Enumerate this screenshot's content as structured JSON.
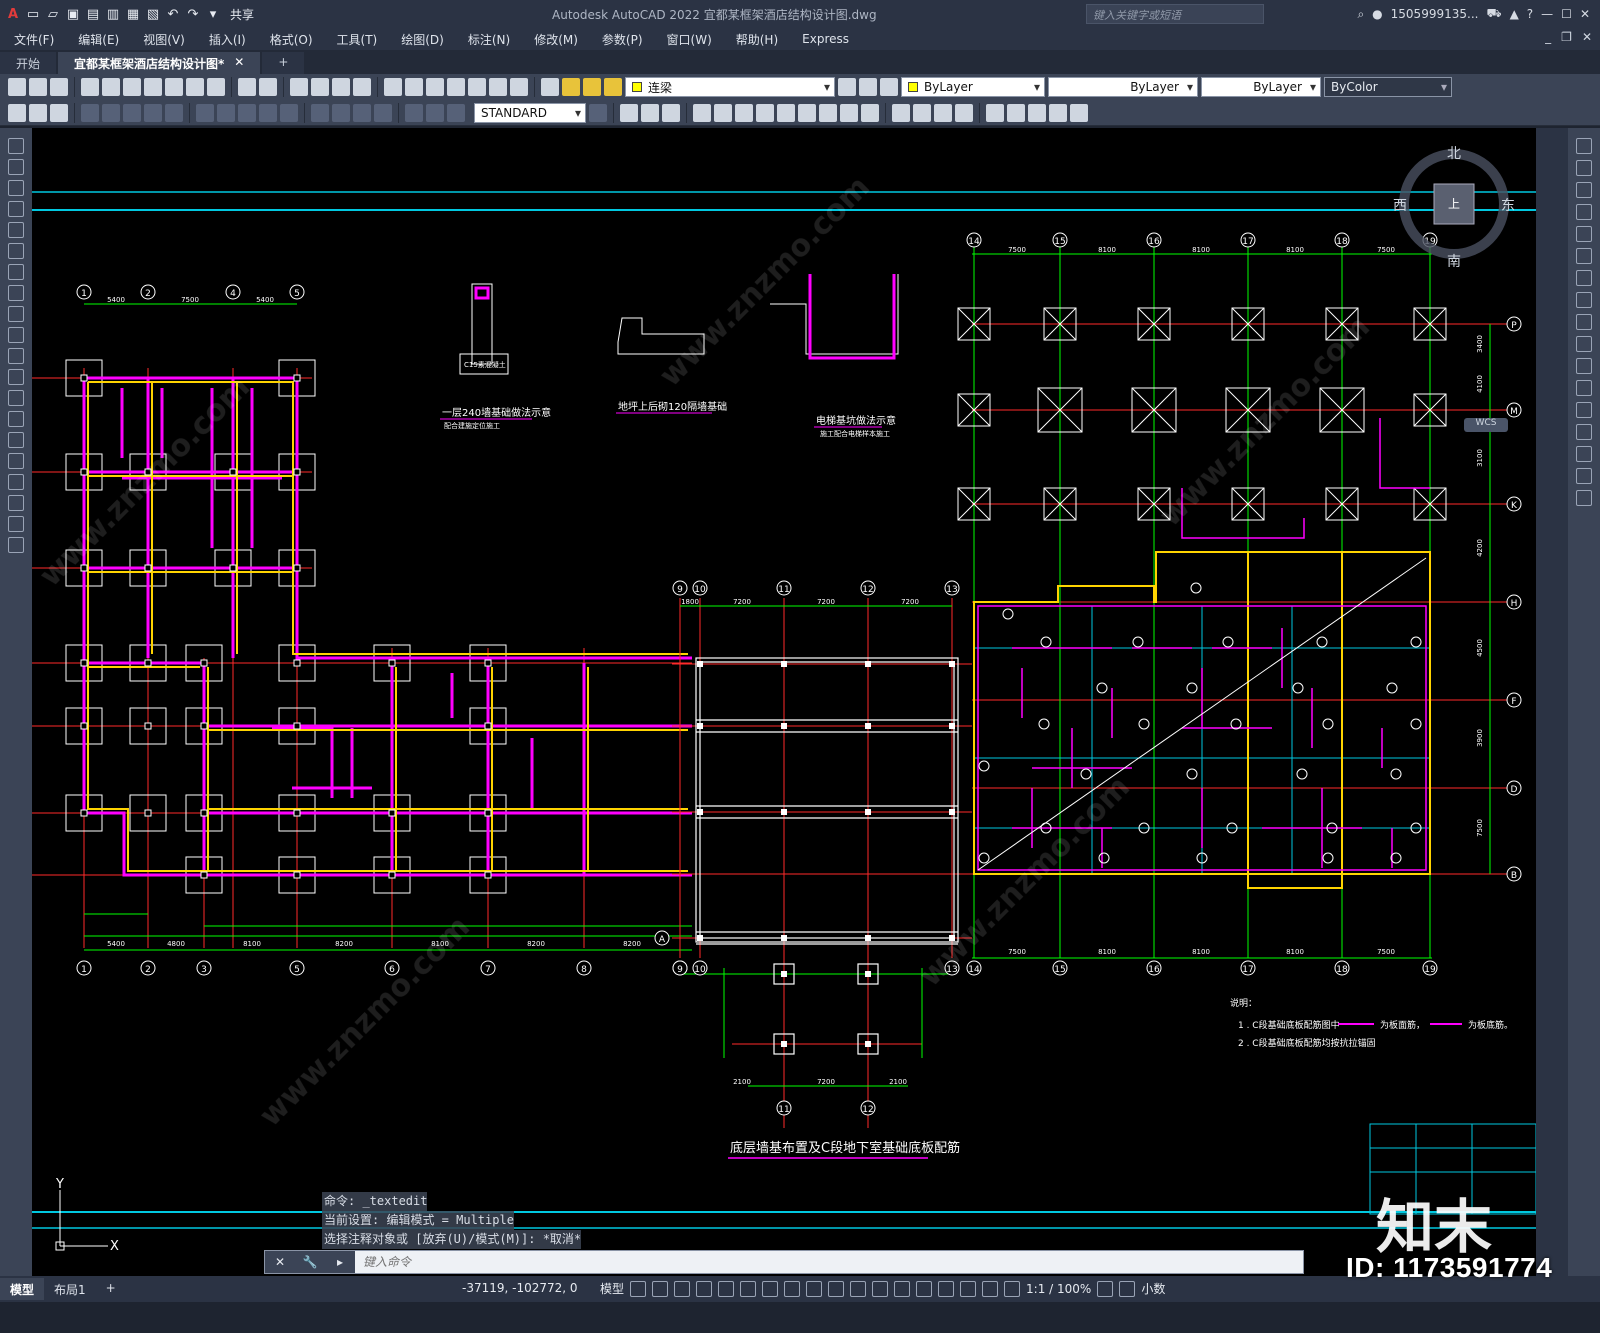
{
  "app": {
    "window_title": "Autodesk AutoCAD 2022    宜都某框架酒店结构设计图.dwg",
    "share_label": "共享",
    "search_placeholder": "键入关键字或短语",
    "user": "1505999135...",
    "logo_letter": "A"
  },
  "menu": [
    "文件(F)",
    "编辑(E)",
    "视图(V)",
    "插入(I)",
    "格式(O)",
    "工具(T)",
    "绘图(D)",
    "标注(N)",
    "修改(M)",
    "参数(P)",
    "窗口(W)",
    "帮助(H)",
    "Express"
  ],
  "tabs": [
    {
      "label": "开始",
      "active": false
    },
    {
      "label": "宜都某框架酒店结构设计图*",
      "active": true
    }
  ],
  "toolbar": {
    "layer_name": "连梁",
    "color": "ByLayer",
    "linetype": "ByLayer",
    "lineweight": "ByLayer",
    "plotstyle": "ByColor",
    "textstyle": "STANDARD"
  },
  "viewcube": {
    "north": "北",
    "south": "南",
    "east": "东",
    "west": "西",
    "top": "上",
    "wcs": "WCS"
  },
  "drawing": {
    "title": "底层墙基布置及C段地下室基础底板配筋",
    "detail1_title": "一层240墙基础做法示意",
    "detail1_sub": "配合建施定位施工",
    "detail1_label": "C15素混凝土",
    "detail2_title": "地坪上后砌120隔墙基础",
    "detail3_title": "电梯基坑做法示意",
    "detail3_sub": "施工配合电梯样本施工",
    "notes_title": "说明：",
    "note1": "1 . C段基础底板配筋图中",
    "note1_a": "为板面筋，",
    "note1_b": "为板底筋。",
    "note2": "2 . C段基础底板配筋均按抗拉锚固",
    "grid_left_top": [
      "1",
      "2",
      "4",
      "5"
    ],
    "grid_left_bottom": [
      "1",
      "2",
      "3",
      "5",
      "6",
      "7",
      "8",
      "9"
    ],
    "grid_mid_top": [
      "9",
      "10",
      "11",
      "12",
      "13"
    ],
    "grid_mid_bottom": [
      "9",
      "10",
      "13"
    ],
    "grid_mid_sub": [
      "11",
      "12"
    ],
    "grid_right": [
      "14",
      "15",
      "16",
      "17",
      "18",
      "19"
    ],
    "grid_right_rows": [
      "P",
      "M",
      "K",
      "H",
      "F",
      "D",
      "B"
    ],
    "grid_a": "A",
    "dims_left_top": [
      "5400",
      "7500",
      "5400"
    ],
    "dims_left_bottom": [
      "5400",
      "4800",
      "8100",
      "8200",
      "8100",
      "8200",
      "8200"
    ],
    "dims_mid_top": [
      "1800",
      "7200",
      "7200",
      "7200"
    ],
    "dims_mid_sub": [
      "2100",
      "7200",
      "2100"
    ],
    "dims_right_top": [
      "7500",
      "8100",
      "8100",
      "8100",
      "7500"
    ],
    "dims_right_side": [
      "3400",
      "4100",
      "3100",
      "4200",
      "4500",
      "3900",
      "7500"
    ]
  },
  "command": {
    "history": [
      "命令: _textedit",
      "当前设置: 编辑模式 = Multiple",
      "选择注释对象或 [放弃(U)/模式(M)]: *取消*"
    ],
    "placeholder": "键入命令"
  },
  "status": {
    "tabs": [
      {
        "label": "模型",
        "active": true
      },
      {
        "label": "布局1",
        "active": false
      }
    ],
    "coords": "-37119, -102772, 0",
    "mode": "模型",
    "scale": "1:1 / 100%",
    "units": "小数"
  },
  "watermark": {
    "id": "ID: 1173591774",
    "logo": "知末",
    "site": "www.znzmo.com"
  },
  "colors": {
    "grid_cyan": "#00c8e0",
    "grid_green": "#00ff00",
    "axis_red": "#ff2a2a",
    "beam_magenta": "#ff00ff",
    "beam_yellow": "#ffd400",
    "line_white": "#ffffff"
  }
}
